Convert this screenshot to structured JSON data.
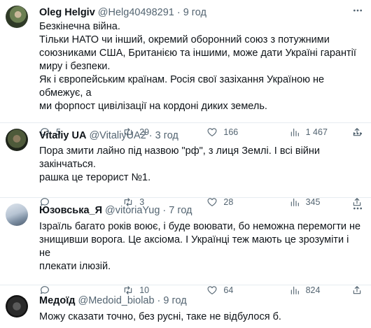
{
  "tweets": [
    {
      "name": "Oleg Helgiv",
      "handle": "@Helg40498291",
      "dot": "·",
      "time": "9 год",
      "lines": [
        "Безкінечна війна.",
        "Тільки НАТО чи інший, окремий оборонний союз з потужними",
        "союзниками США, Британією та іншими, може дати Україні гарантії",
        "миру і безпеки.",
        "Як і європейським країнам. Росія свої зазіхання Україною не обмежує, а",
        "ми форпост цивілізації на кордоні диких земель."
      ],
      "replies": "5",
      "retweets": "29",
      "likes": "166",
      "views": "1 467"
    },
    {
      "name": "Vitaliy UA",
      "handle": "@VitaliyUA2",
      "dot": "·",
      "time": "3 год",
      "lines": [
        "Пора змити лайно під назвою \"рф\", з лиця Землі. І всі війни закінчаться.",
        "рашка це терорист №1."
      ],
      "replies": "",
      "retweets": "3",
      "likes": "28",
      "views": "345"
    },
    {
      "name": "Юзовська_Я",
      "handle": "@vitoriaYug",
      "dot": "·",
      "time": "7 год",
      "lines": [
        "Ізраїль багато років воює, і буде воювати, бо неможна перемогти не",
        "знищивши ворога. Це аксіома. І Українці теж мають це зрозуміти і не",
        "плекати ілюзій."
      ],
      "replies": "",
      "retweets": "10",
      "likes": "64",
      "views": "824"
    },
    {
      "name": "Медоїд",
      "handle": "@Medoid_biolab",
      "dot": "·",
      "time": "9 год",
      "lines": [
        "Можу сказати точно, без русні, таке не відбулося б."
      ]
    }
  ]
}
